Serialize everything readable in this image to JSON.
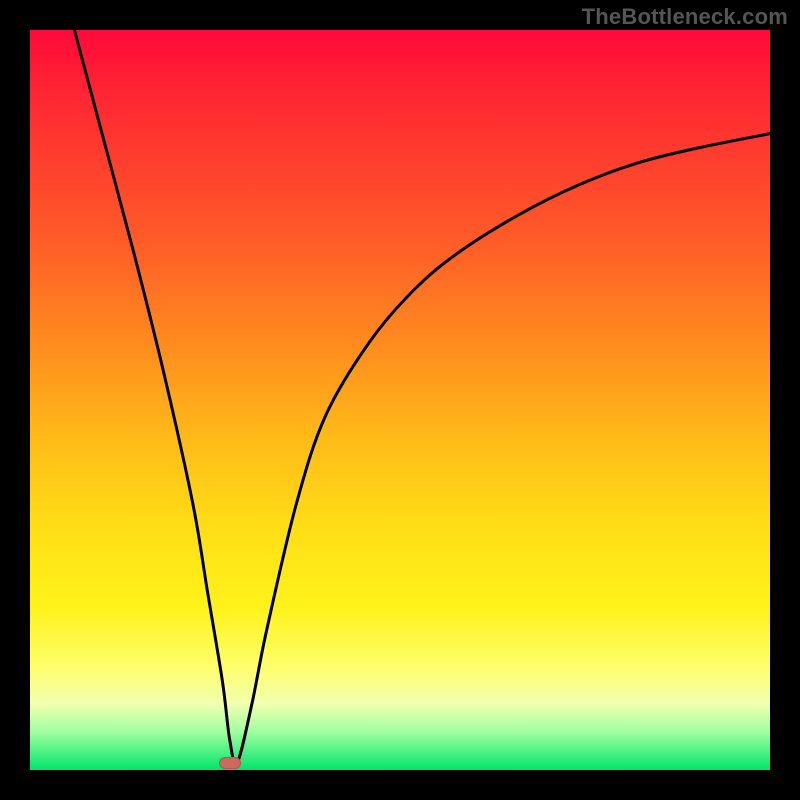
{
  "watermark": "TheBottleneck.com",
  "chart_data": {
    "type": "line",
    "title": "",
    "xlabel": "",
    "ylabel": "",
    "xlim": [
      0,
      100
    ],
    "ylim": [
      0,
      100
    ],
    "grid": false,
    "legend": false,
    "series": [
      {
        "name": "bottleneck-curve",
        "x": [
          6,
          10,
          14,
          18,
          22,
          24,
          26,
          27,
          28,
          30,
          32,
          36,
          40,
          46,
          52,
          58,
          66,
          74,
          82,
          90,
          100
        ],
        "y": [
          100,
          85,
          70,
          54,
          36,
          24,
          12,
          4,
          1,
          9,
          19,
          36,
          48,
          58,
          65,
          70,
          75,
          79,
          82,
          84,
          86
        ]
      }
    ],
    "annotations": [
      {
        "name": "minimum-marker",
        "x": 27,
        "y": 1
      }
    ],
    "background_gradient": {
      "stops": [
        {
          "pos": 0,
          "color": "#ff0a3a"
        },
        {
          "pos": 10,
          "color": "#ff2a32"
        },
        {
          "pos": 28,
          "color": "#ff5a28"
        },
        {
          "pos": 42,
          "color": "#ff8a1f"
        },
        {
          "pos": 55,
          "color": "#ffba18"
        },
        {
          "pos": 68,
          "color": "#ffe016"
        },
        {
          "pos": 78,
          "color": "#fff21a"
        },
        {
          "pos": 86,
          "color": "#feff6a"
        },
        {
          "pos": 91,
          "color": "#f2ffb0"
        },
        {
          "pos": 95,
          "color": "#9cffa0"
        },
        {
          "pos": 100,
          "color": "#00e46a"
        }
      ]
    }
  }
}
